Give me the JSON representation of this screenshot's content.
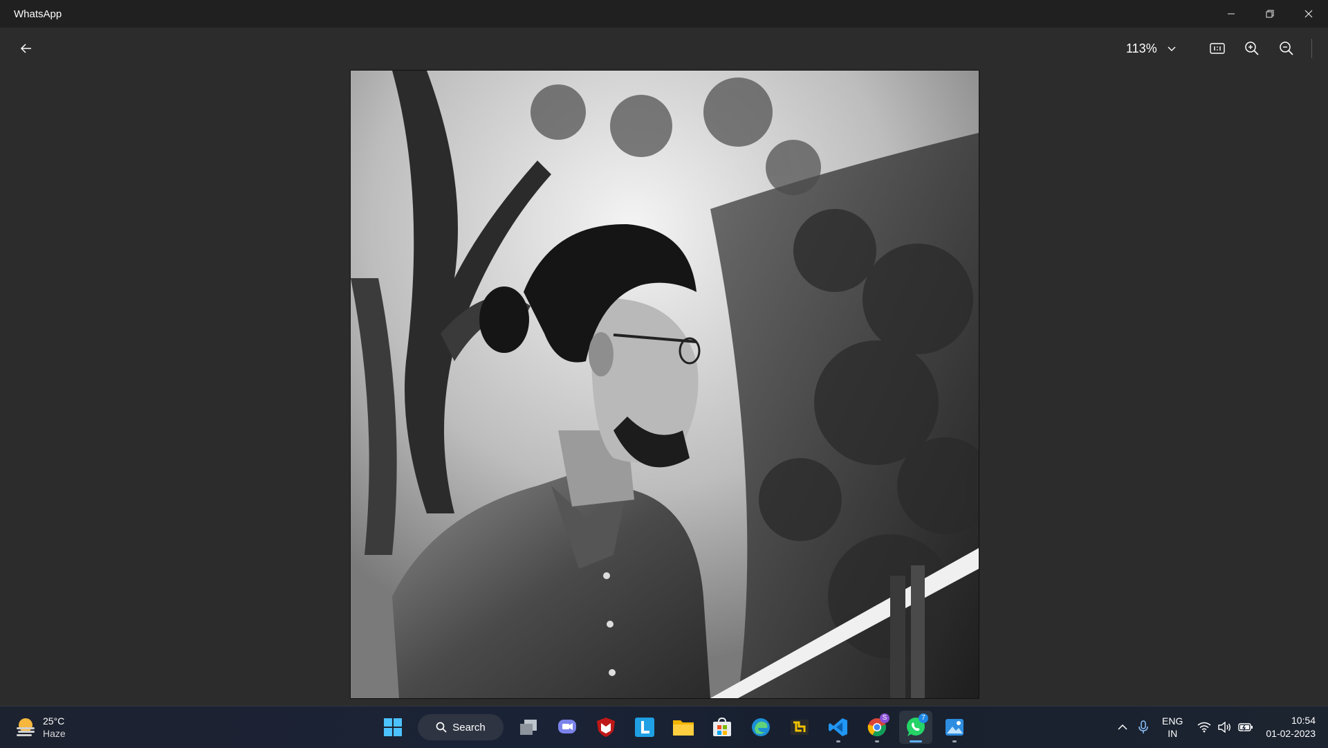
{
  "window": {
    "title": "WhatsApp"
  },
  "viewer": {
    "zoom_label": "113%"
  },
  "taskbar": {
    "weather": {
      "temperature": "25°C",
      "condition": "Haze"
    },
    "search_label": "Search",
    "badges": {
      "chrome": "S",
      "whatsapp": "7"
    },
    "tray": {
      "lang_line1": "ENG",
      "lang_line2": "IN",
      "time": "10:54",
      "date": "01-02-2023"
    }
  },
  "colors": {
    "accent": "#5fb2ff",
    "whatsapp_green": "#25d366",
    "badge_purple": "#8a4fd6",
    "badge_blue": "#1e88e5"
  }
}
